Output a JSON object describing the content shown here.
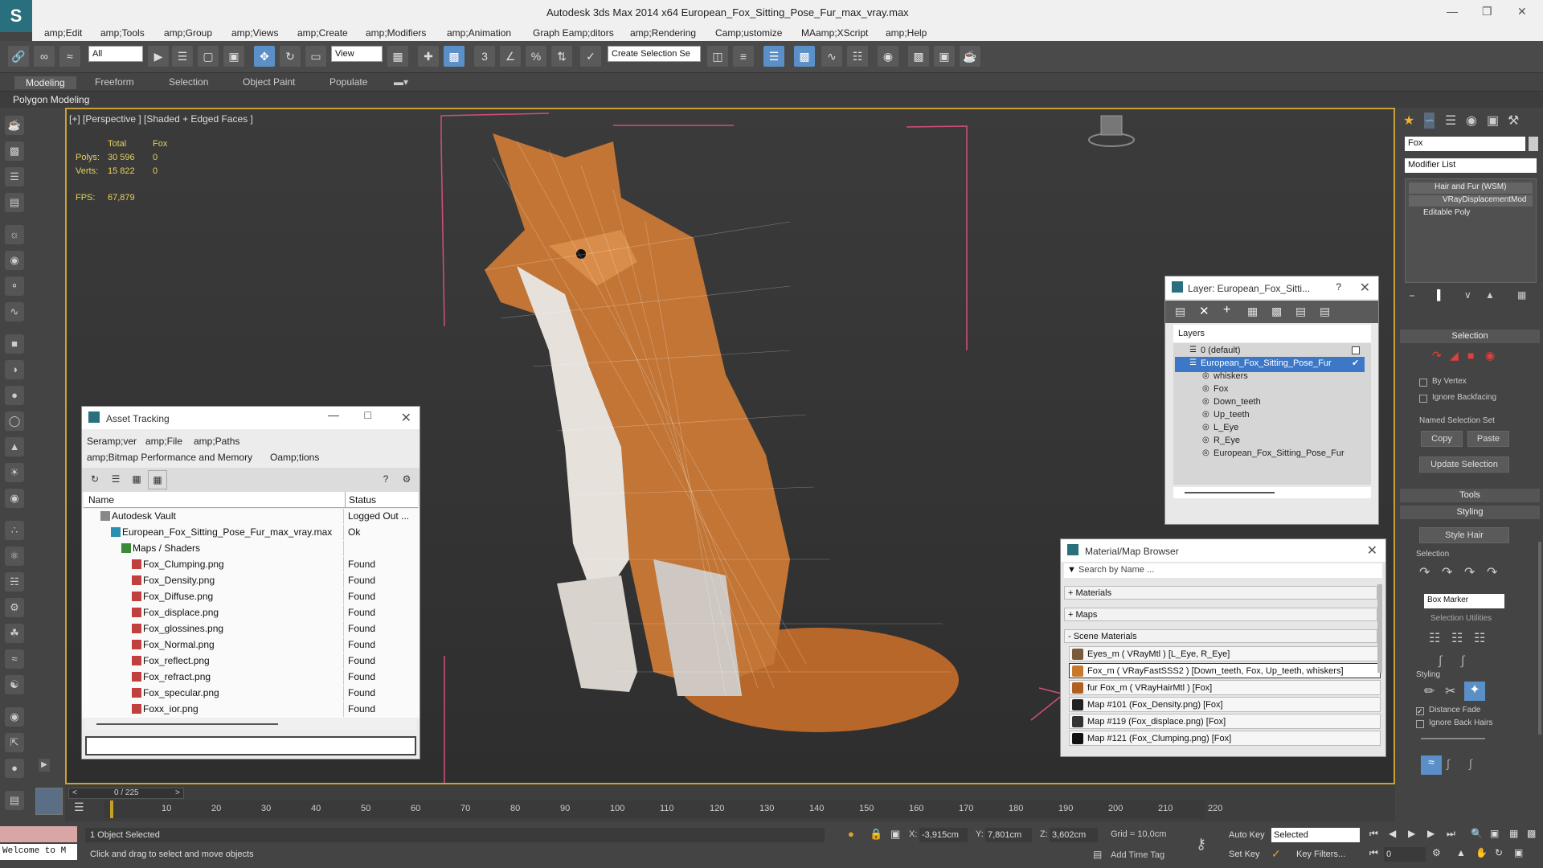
{
  "window": {
    "title": "Autodesk 3ds Max  2014 x64     European_Fox_Sitting_Pose_Fur_max_vray.max"
  },
  "menu": [
    "amp;Edit",
    "amp;Tools",
    "amp;Group",
    "amp;Views",
    "amp;Create",
    "amp;Modifiers",
    "amp;Animation",
    "Graph Eamp;ditors",
    "amp;Rendering",
    "Camp;ustomize",
    "MAamp;XScript",
    "amp;Help"
  ],
  "toolbar": {
    "filter": "All",
    "view": "View",
    "selection_set": "Create Selection Se"
  },
  "ribbon": {
    "tabs": [
      "Modeling",
      "Freeform",
      "Selection",
      "Object Paint",
      "Populate"
    ],
    "active": "Modeling",
    "sub": "Polygon Modeling"
  },
  "viewport": {
    "label": "[+] [Perspective ] [Shaded + Edged Faces ]",
    "stats": {
      "h_total": "Total",
      "h_obj": "Fox",
      "polys_label": "Polys:",
      "polys_total": "30 596",
      "polys_obj": "0",
      "verts_label": "Verts:",
      "verts_total": "15 822",
      "verts_obj": "0",
      "fps_label": "FPS:",
      "fps": "67,879"
    }
  },
  "asset_tracking": {
    "title": "Asset Tracking",
    "menu": [
      "Seramp;ver",
      "amp;File",
      "amp;Paths",
      "amp;Bitmap Performance and Memory",
      "Oamp;tions"
    ],
    "col_name": "Name",
    "col_status": "Status",
    "rows": [
      {
        "name": "Autodesk Vault",
        "status": "Logged Out ...",
        "indent": 1,
        "icon": "vault"
      },
      {
        "name": "European_Fox_Sitting_Pose_Fur_max_vray.max",
        "status": "Ok",
        "indent": 2,
        "icon": "max"
      },
      {
        "name": "Maps / Shaders",
        "status": "",
        "indent": 3,
        "icon": "folder"
      },
      {
        "name": "Fox_Clumping.png",
        "status": "Found",
        "indent": 4,
        "icon": "png"
      },
      {
        "name": "Fox_Density.png",
        "status": "Found",
        "indent": 4,
        "icon": "png"
      },
      {
        "name": "Fox_Diffuse.png",
        "status": "Found",
        "indent": 4,
        "icon": "png"
      },
      {
        "name": "Fox_displace.png",
        "status": "Found",
        "indent": 4,
        "icon": "png"
      },
      {
        "name": "Fox_glossines.png",
        "status": "Found",
        "indent": 4,
        "icon": "png"
      },
      {
        "name": "Fox_Normal.png",
        "status": "Found",
        "indent": 4,
        "icon": "png"
      },
      {
        "name": "Fox_reflect.png",
        "status": "Found",
        "indent": 4,
        "icon": "png"
      },
      {
        "name": "Fox_refract.png",
        "status": "Found",
        "indent": 4,
        "icon": "png"
      },
      {
        "name": "Fox_specular.png",
        "status": "Found",
        "indent": 4,
        "icon": "png"
      },
      {
        "name": "Foxx_ior.png",
        "status": "Found",
        "indent": 4,
        "icon": "png"
      }
    ]
  },
  "layer": {
    "title": "Layer: European_Fox_Sitti...",
    "help": "?",
    "header": "Layers",
    "items": [
      {
        "name": "0 (default)",
        "level": 0
      },
      {
        "name": "European_Fox_Sitting_Pose_Fur",
        "level": 0,
        "selected": true
      },
      {
        "name": "whiskers",
        "level": 1
      },
      {
        "name": "Fox",
        "level": 1
      },
      {
        "name": "Down_teeth",
        "level": 1
      },
      {
        "name": "Up_teeth",
        "level": 1
      },
      {
        "name": "L_Eye",
        "level": 1
      },
      {
        "name": "R_Eye",
        "level": 1
      },
      {
        "name": "European_Fox_Sitting_Pose_Fur",
        "level": 1
      }
    ]
  },
  "material": {
    "title": "Material/Map Browser",
    "search": "Search by Name ...",
    "groups": [
      "+ Materials",
      "+ Maps",
      "- Scene Materials"
    ],
    "items": [
      {
        "text": "Eyes_m  ( VRayMtl ) [L_Eye, R_Eye]",
        "color": "#7a5a3a"
      },
      {
        "text": "Fox_m  ( VRayFastSSS2 ) [Down_teeth, Fox, Up_teeth, whiskers]",
        "color": "#c8782a",
        "selected": true
      },
      {
        "text": "fur Fox_m  ( VRayHairMtl ) [Fox]",
        "color": "#b06020"
      },
      {
        "text": "Map #101 (Fox_Density.png)  [Fox]",
        "color": "#222"
      },
      {
        "text": "Map #119 (Fox_displace.png)  [Fox]",
        "color": "#333"
      },
      {
        "text": "Map #121 (Fox_Clumping.png)  [Fox]",
        "color": "#111"
      }
    ]
  },
  "command_panel": {
    "object_name": "Fox",
    "modifier_list": "Modifier List",
    "stack": [
      "Hair and Fur (WSM)",
      "VRayDisplacementMod",
      "Editable Poly"
    ],
    "selection_title": "Selection",
    "by_vertex": "By Vertex",
    "ignore_backfacing": "Ignore Backfacing",
    "named_selection": "Named Selection Set",
    "copy": "Copy",
    "paste": "Paste",
    "update_selection": "Update Selection",
    "tools": "Tools",
    "styling": "Styling",
    "style_hair": "Style Hair",
    "sel_label": "Selection",
    "box_marker": "Box Marker",
    "sel_utils": "Selection Utilities",
    "styling_sub": "Styling",
    "distance_fade": "Distance Fade",
    "ignore_back_hairs": "Ignore Back Hairs"
  },
  "timeline": {
    "frame": "0 / 225",
    "ticks": [
      "10",
      "20",
      "30",
      "40",
      "50",
      "60",
      "70",
      "80",
      "90",
      "100",
      "110",
      "120",
      "130",
      "140",
      "150",
      "160",
      "170",
      "180",
      "190",
      "200",
      "210",
      "220"
    ]
  },
  "status": {
    "maxscript": "Welcome to M",
    "selected": "1 Object Selected",
    "prompt": "Click and drag to select and move objects",
    "x_label": "X:",
    "x": "-3,915cm",
    "y_label": "Y:",
    "y": "7,801cm",
    "z_label": "Z:",
    "z": "3,602cm",
    "grid": "Grid = 10,0cm",
    "auto_key": "Auto Key",
    "set_key": "Set Key",
    "key_mode": "Selected",
    "key_filters": "Key Filters...",
    "add_time_tag": "Add Time Tag",
    "frame_field": "0"
  }
}
